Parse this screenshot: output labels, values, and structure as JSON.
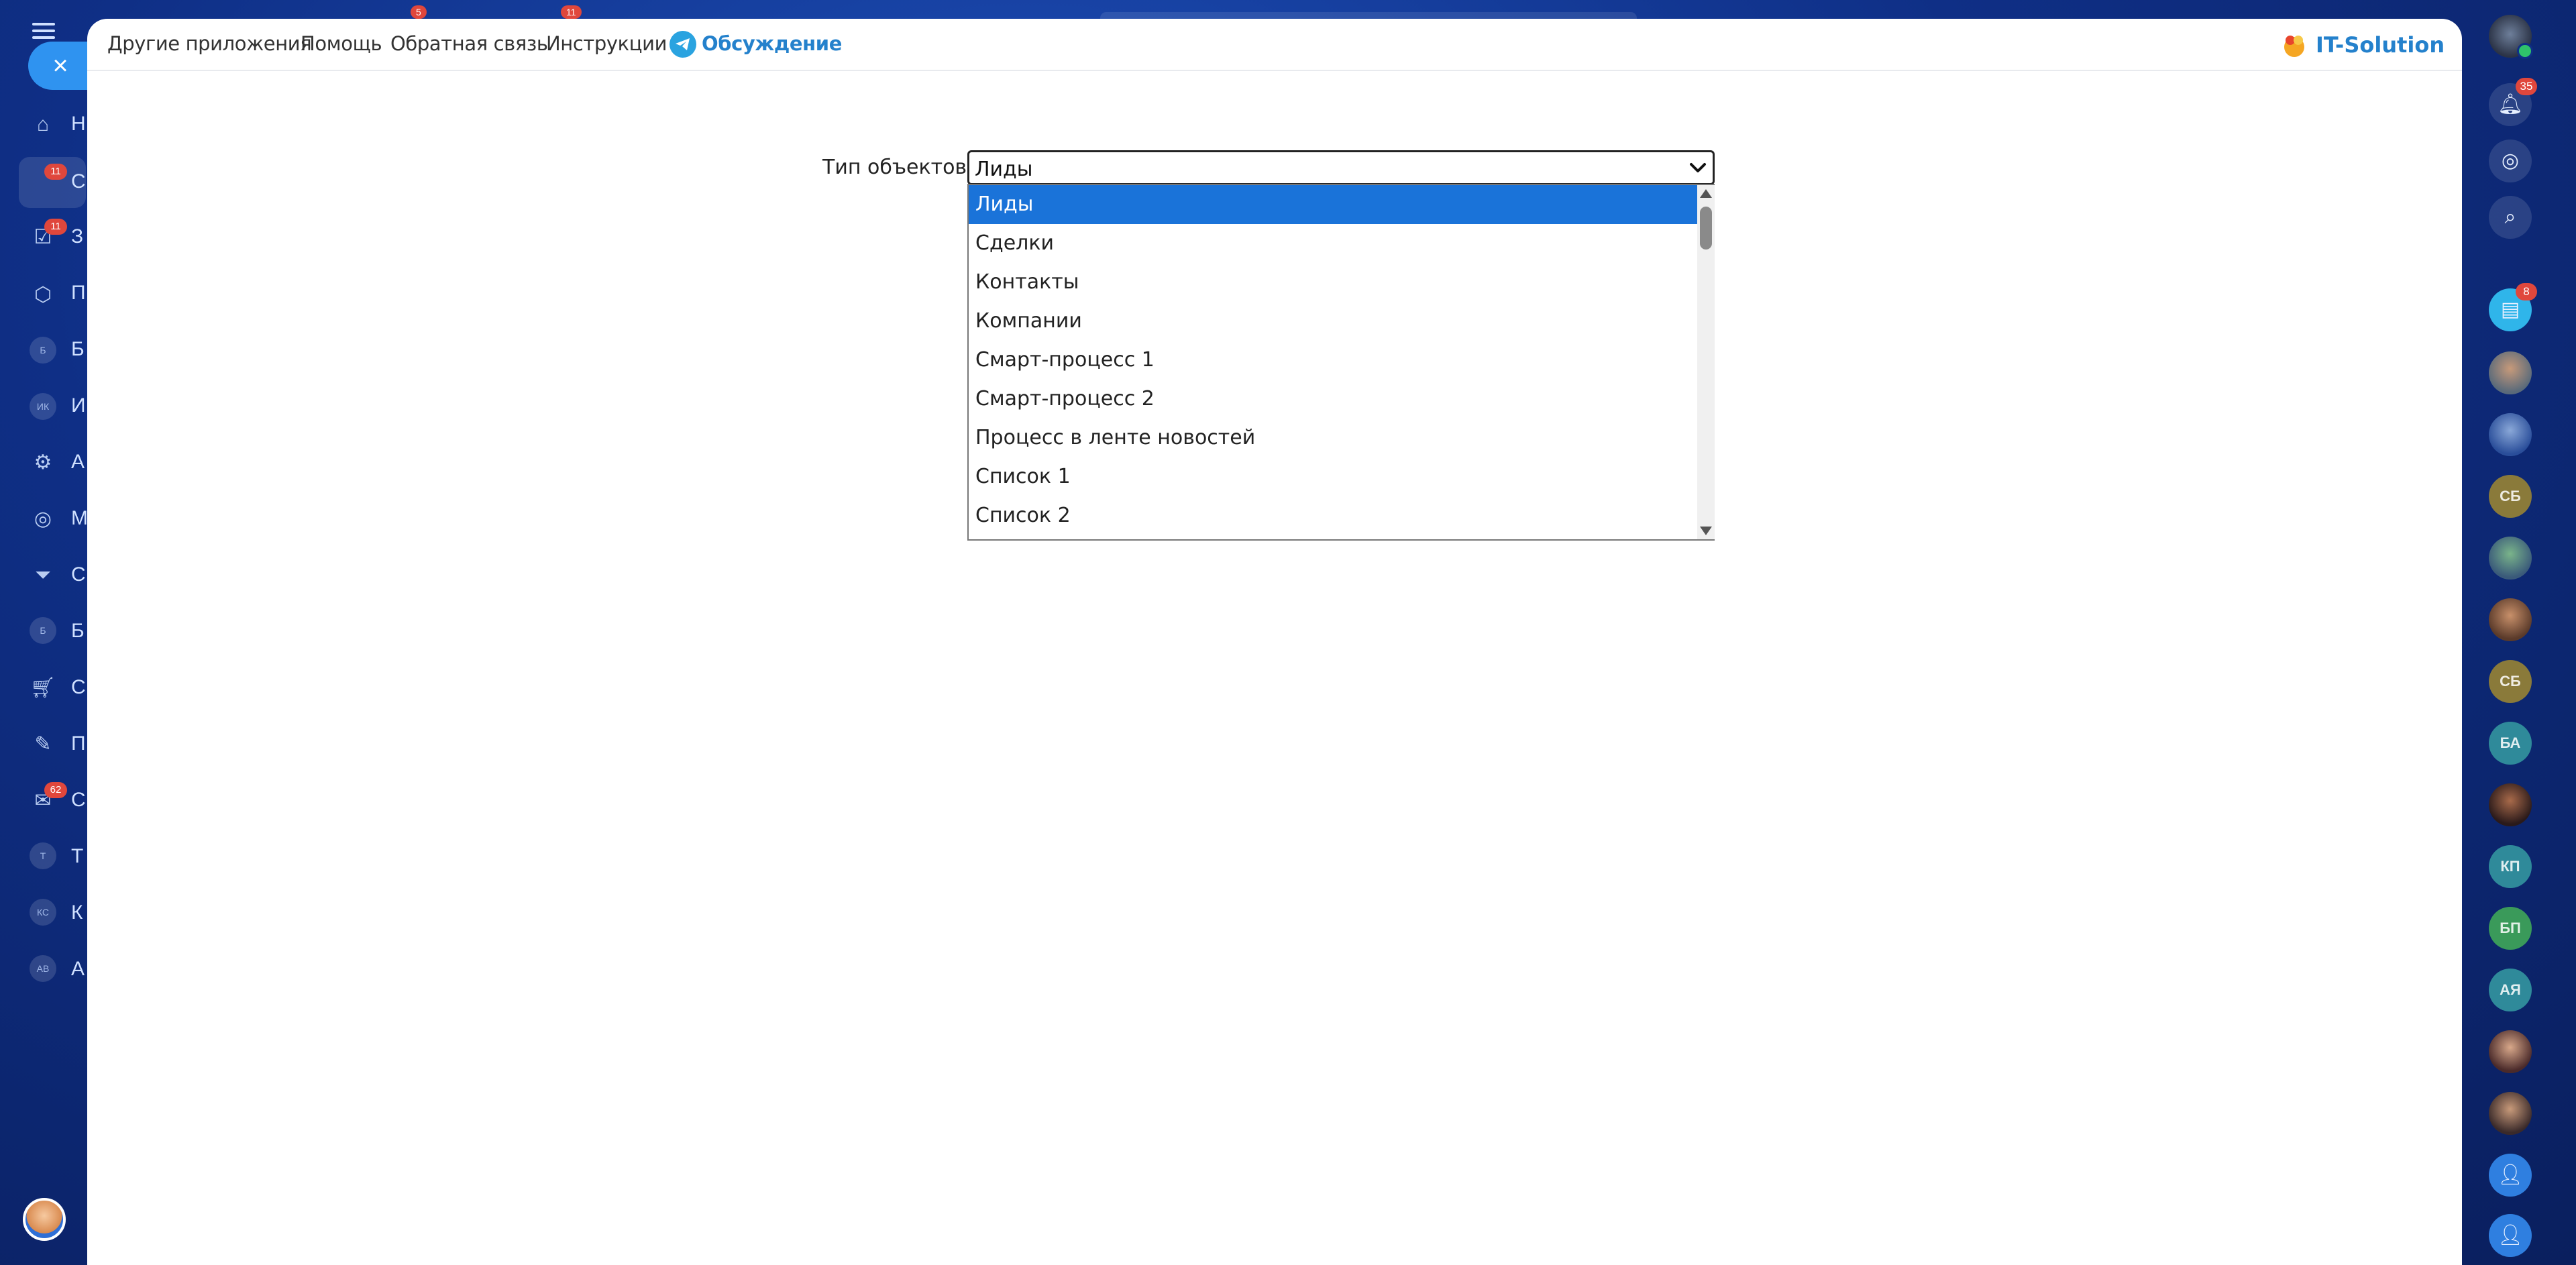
{
  "app": {
    "nav": {
      "other_apps": "Другие приложения",
      "help": "Помощь",
      "feedback": "Обратная связь",
      "instructions": "Инструкции",
      "discussion": "Обсуждение"
    },
    "brand": {
      "name": "IT-Solution",
      "logo_icon": "it-solution-logo-icon"
    }
  },
  "background": {
    "close_label": "×",
    "left_menu_letters": [
      "Н",
      "С",
      "З",
      "П",
      "Б",
      "И",
      "А",
      "М",
      "С",
      "Б",
      "С",
      "П",
      "С",
      "Т",
      "К",
      "А"
    ],
    "left_menu_badges": [
      "11",
      "11",
      "62"
    ],
    "left_menu_initials": [
      "Б",
      "ИК",
      "Б",
      "Т",
      "КС",
      "АВ"
    ],
    "top_badges": [
      "5",
      "11"
    ],
    "right_bar": {
      "notifications_badge": "35",
      "chat_badge": "8",
      "initials": [
        "СБ",
        "СБ",
        "БА",
        "КП",
        "БП",
        "АЯ"
      ]
    }
  },
  "form": {
    "object_type_label": "Тип объектов:",
    "selected_value": "Лиды",
    "options": [
      "Лиды",
      "Сделки",
      "Контакты",
      "Компании",
      "Смарт-процесс 1",
      "Смарт-процесс 2",
      "Процесс в ленте новостей",
      "Список 1",
      "Список 2"
    ]
  },
  "colors": {
    "accent": "#2481cc",
    "selection": "#1a73d9",
    "background_dark": "#0f2f86",
    "badge_red": "#e0473c"
  }
}
